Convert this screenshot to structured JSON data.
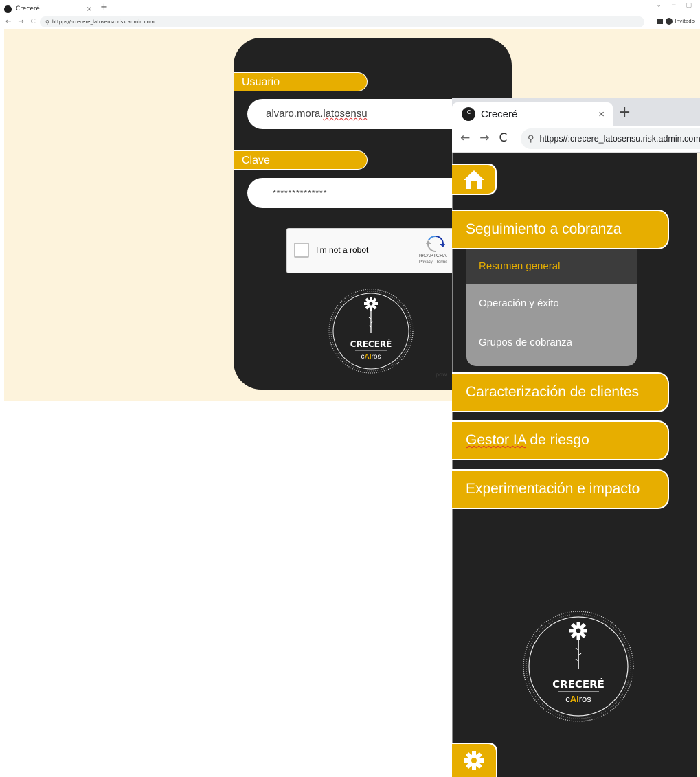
{
  "back_window": {
    "tab_title": "Creceré",
    "url": "httpps//:crecere_latosensu.risk.admin.com",
    "profile_label": "Invitado",
    "login": {
      "user_label": "Usuario",
      "user_value": "alvaro.mora.latosensu",
      "password_label": "Clave",
      "password_value": "**************",
      "captcha_text": "I'm not a robot",
      "captcha_brand": "reCAPTCHA",
      "captcha_links": "Privacy - Terms",
      "powered_text": "pow"
    },
    "logo": {
      "brand": "CRECERÉ",
      "sub_pre": "c",
      "sub_highlight": "AI",
      "sub_post": "ros"
    }
  },
  "front_window": {
    "tab_title": "Creceré",
    "url": "httpps//:crecere_latosensu.risk.admin.com",
    "menu": [
      {
        "label": "Seguimiento a cobranza"
      },
      {
        "label": "Caracterización de clientes"
      },
      {
        "label_underlined": "Gestor IA",
        "label_rest": " de riesgo"
      },
      {
        "label": "Experimentación e impacto"
      }
    ],
    "submenu": [
      {
        "label": "Resumen general"
      },
      {
        "label": "Operación y éxito"
      },
      {
        "label": "Grupos de cobranza"
      }
    ],
    "logo": {
      "brand": "CRECERÉ",
      "sub_pre": "c",
      "sub_highlight": "AI",
      "sub_post": "ros"
    }
  },
  "colors": {
    "accent": "#e7ae00",
    "panel": "#222222",
    "page_bg": "#fdf3dc",
    "submenu_bg": "#9a9a9a",
    "submenu_active_bg": "#3c3c3c"
  },
  "icons": [
    "home-icon",
    "gear-icon",
    "search-icon",
    "recaptcha-icon",
    "sunflower-gear-logo"
  ]
}
